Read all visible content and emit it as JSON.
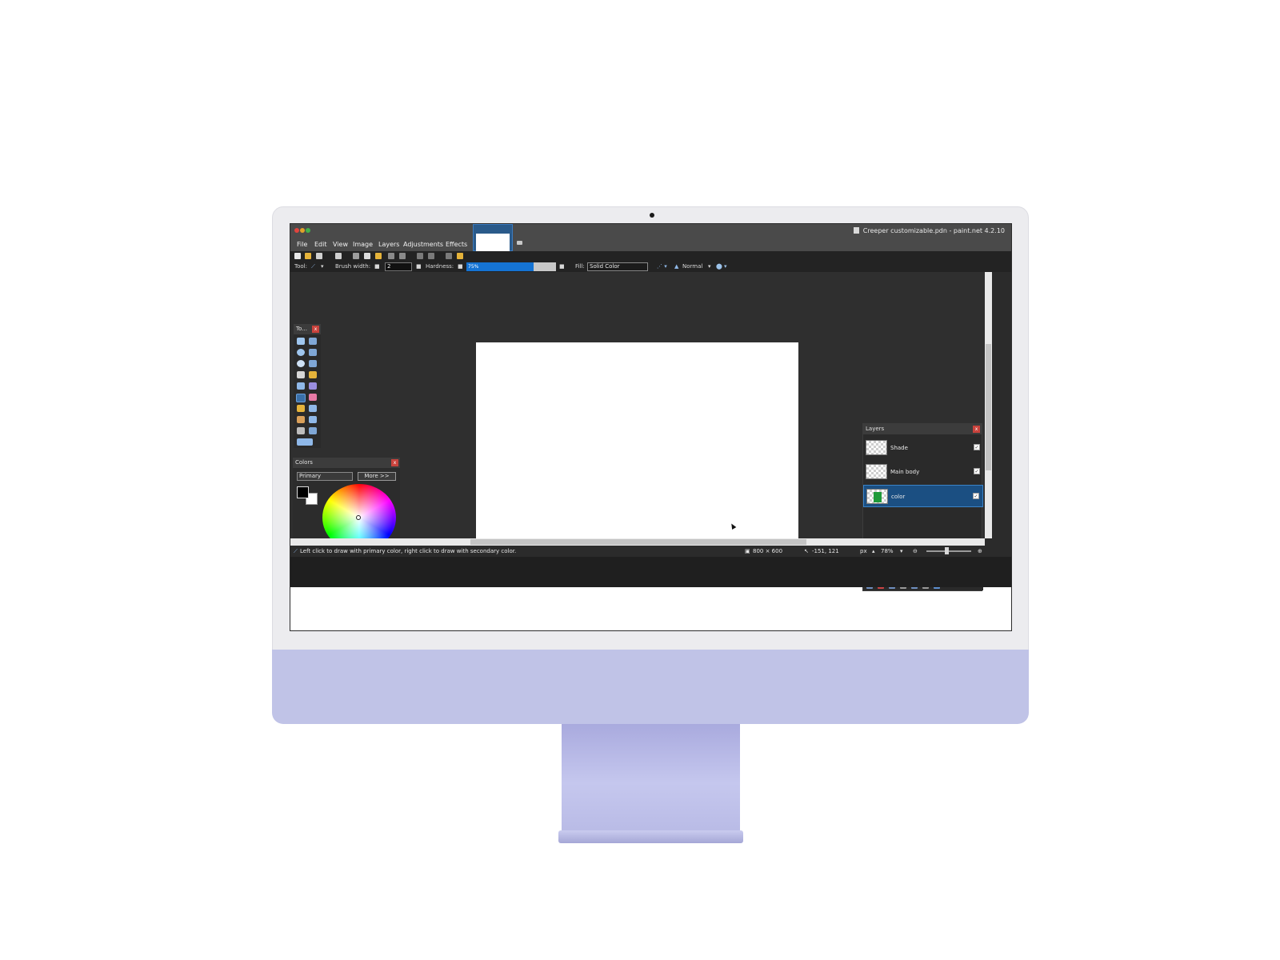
{
  "window": {
    "title": "Creeper customizable.pdn - paint.net 4.2.10"
  },
  "menu": [
    "File",
    "Edit",
    "View",
    "Image",
    "Layers",
    "Adjustments",
    "Effects"
  ],
  "toolbar": {
    "tool_label": "Tool:",
    "brush_width_label": "Brush width:",
    "brush_width_value": "2",
    "hardness_label": "Hardness:",
    "hardness_value": "75%",
    "hardness_level": 0.75,
    "fill_label": "Fill:",
    "fill_value": "Solid Color",
    "blend_mode": "Normal"
  },
  "tools_panel": {
    "title": "To..."
  },
  "colors_panel": {
    "title": "Colors",
    "selector_value": "Primary",
    "more_button": "More >>",
    "primary_color": "#000000",
    "secondary_color": "#ffffff"
  },
  "layers_panel": {
    "title": "Layers",
    "layers": [
      {
        "name": "Shade",
        "visible": true,
        "selected": false
      },
      {
        "name": "Main body",
        "visible": true,
        "selected": false
      },
      {
        "name": "color",
        "visible": true,
        "selected": true
      }
    ]
  },
  "status": {
    "hint": "Left click to draw with primary color, right click to draw with secondary color.",
    "image_size": "800 × 600",
    "cursor_pos": "-151, 121",
    "units": "px",
    "zoom": "78%"
  },
  "colors": {
    "accent": "#1573d3",
    "selection": "#1b4f82",
    "frame_purple": "#c0c3e7"
  }
}
